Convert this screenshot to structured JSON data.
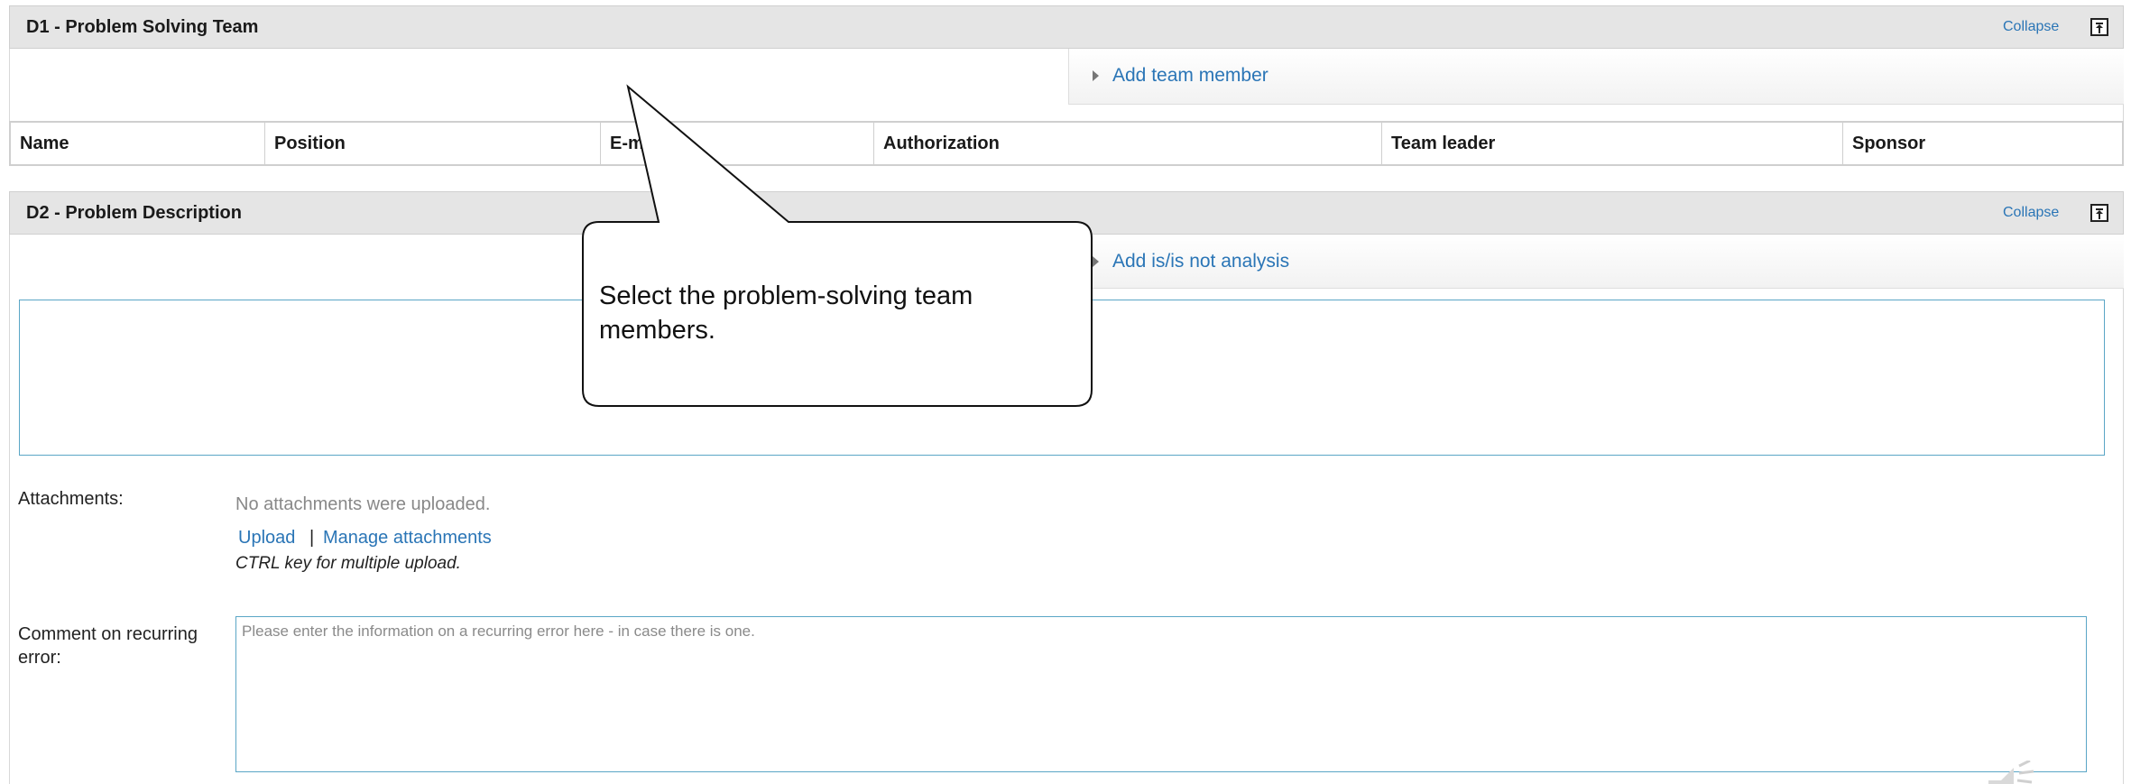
{
  "d1": {
    "title": "D1 - Problem Solving Team",
    "collapse_label": "Collapse",
    "add_member_label": "Add team member",
    "columns": [
      "Name",
      "Position",
      "E-mail",
      "Authorization",
      "Team leader",
      "Sponsor"
    ]
  },
  "d2": {
    "title": "D2 - Problem Description",
    "collapse_label": "Collapse",
    "add_analysis_label": "Add is/is not analysis",
    "description_value": "",
    "attachments_label": "Attachments:",
    "no_attachments": "No attachments were uploaded.",
    "upload_label": "Upload",
    "separator": "|",
    "manage_label": "Manage attachments",
    "ctrl_hint": "CTRL key for multiple upload.",
    "comment_label": "Comment on recurring error:",
    "comment_placeholder": "Please enter the information on a recurring error here - in case there is one."
  },
  "callout": {
    "text": "Select the problem-solving team members."
  },
  "colors": {
    "link": "#2a75b6",
    "header_bg": "#e5e5e5",
    "input_border": "#5aa6c6"
  },
  "icons": [
    "collapse-icon",
    "expand-triangle-icon",
    "speaker-icon"
  ]
}
